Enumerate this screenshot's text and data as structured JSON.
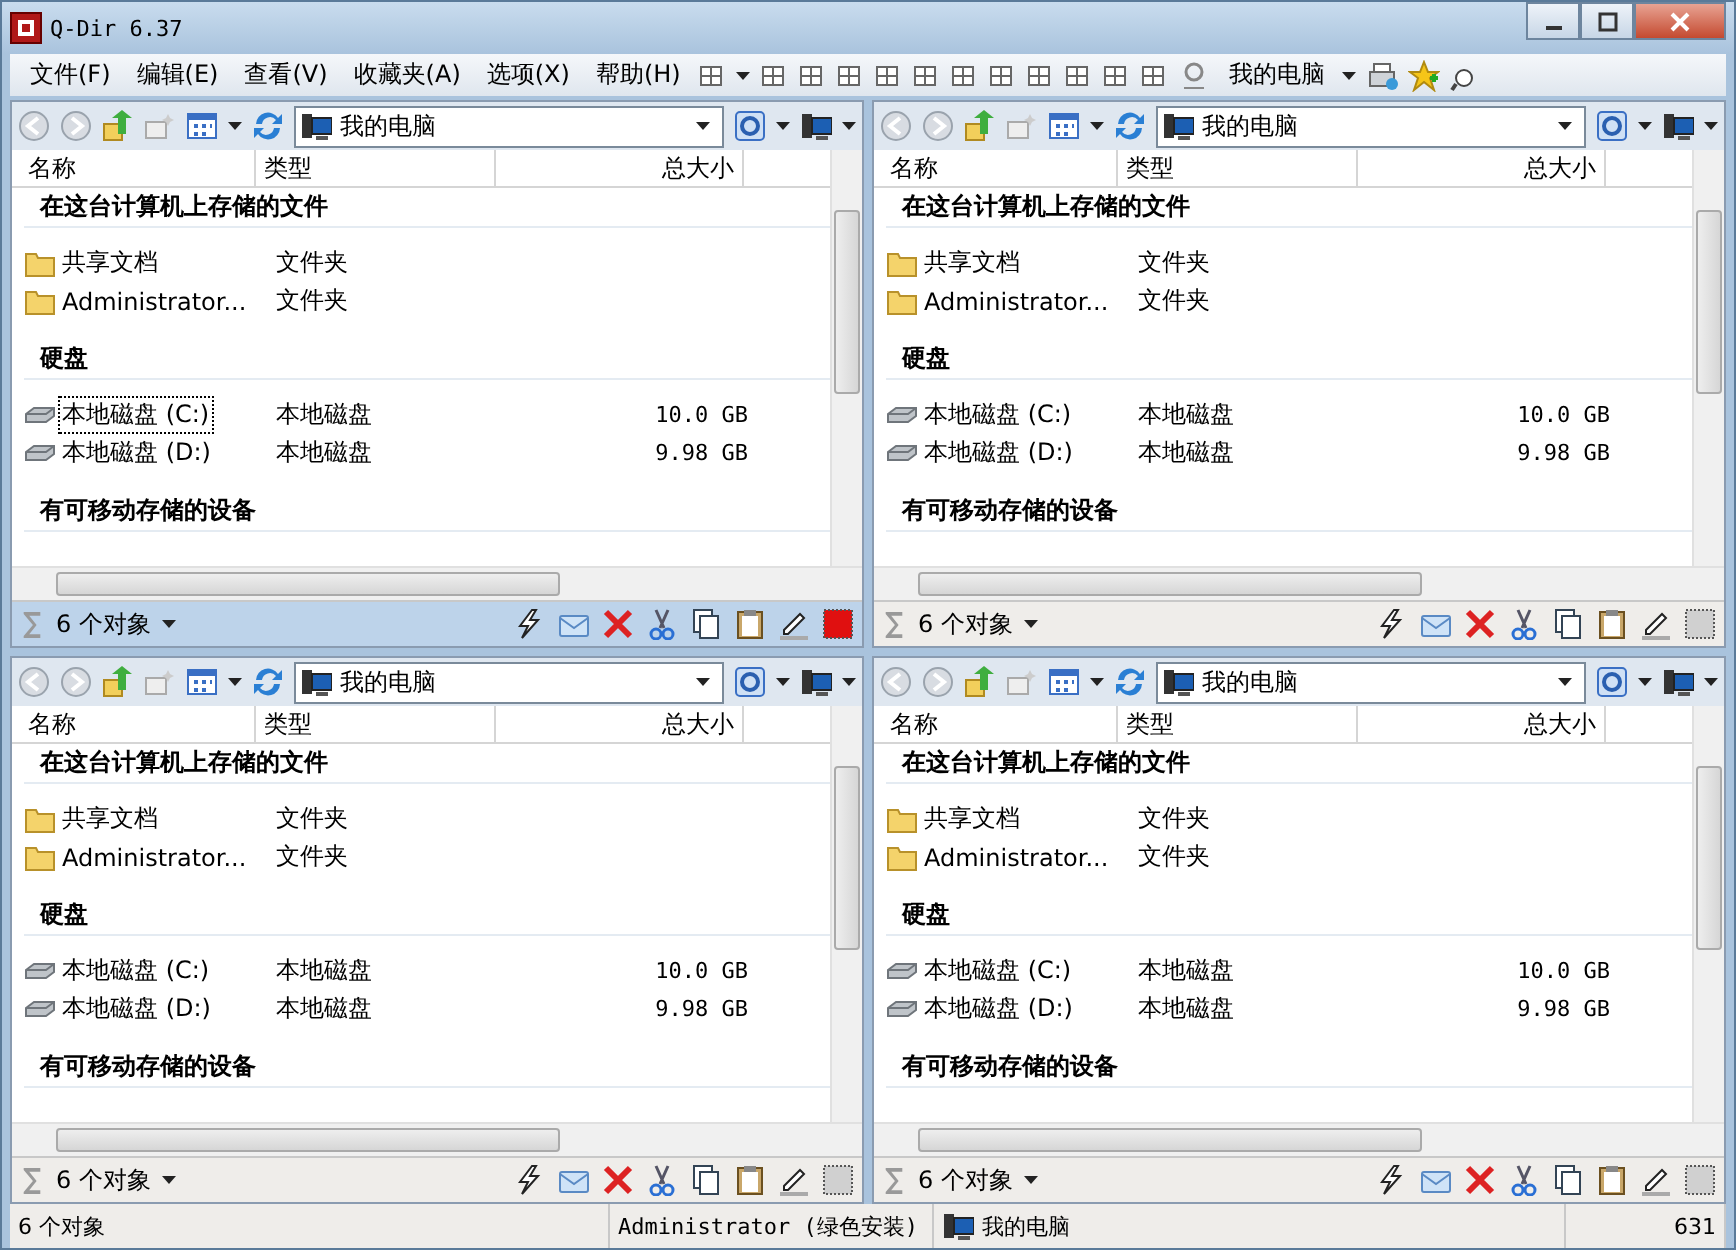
{
  "window": {
    "title": "Q-Dir 6.37"
  },
  "menu": [
    {
      "label": "文件(F)"
    },
    {
      "label": "编辑(E)"
    },
    {
      "label": "查看(V)"
    },
    {
      "label": "收藏夹(A)"
    },
    {
      "label": "选项(X)"
    },
    {
      "label": "帮助(H)"
    }
  ],
  "toolbar": {
    "location": "我的电脑"
  },
  "panes": [
    {
      "selected": true,
      "address": "我的电脑",
      "columns": [
        "名称",
        "类型",
        "总大小"
      ],
      "status": "6 个对象",
      "groups": [
        {
          "title": "在这台计算机上存储的文件",
          "items": [
            {
              "kind": "folder",
              "name": "共享文档",
              "type": "文件夹",
              "focused": false
            },
            {
              "kind": "folder",
              "name": "Administrator...",
              "type": "文件夹",
              "focused": false
            }
          ]
        },
        {
          "title": "硬盘",
          "items": [
            {
              "kind": "drive",
              "name": "本地磁盘 (C:)",
              "type": "本地磁盘",
              "size": "10.0 GB",
              "focused": true
            },
            {
              "kind": "drive",
              "name": "本地磁盘 (D:)",
              "type": "本地磁盘",
              "size": "9.98 GB",
              "focused": false
            }
          ]
        },
        {
          "title": "有可移动存储的设备"
        }
      ]
    },
    {
      "selected": false,
      "address": "我的电脑",
      "columns": [
        "名称",
        "类型",
        "总大小"
      ],
      "status": "6 个对象",
      "groups": [
        {
          "title": "在这台计算机上存储的文件",
          "items": [
            {
              "kind": "folder",
              "name": "共享文档",
              "type": "文件夹",
              "focused": false
            },
            {
              "kind": "folder",
              "name": "Administrator...",
              "type": "文件夹",
              "focused": false
            }
          ]
        },
        {
          "title": "硬盘",
          "items": [
            {
              "kind": "drive",
              "name": "本地磁盘 (C:)",
              "type": "本地磁盘",
              "size": "10.0 GB",
              "focused": false
            },
            {
              "kind": "drive",
              "name": "本地磁盘 (D:)",
              "type": "本地磁盘",
              "size": "9.98 GB",
              "focused": false
            }
          ]
        },
        {
          "title": "有可移动存储的设备"
        }
      ]
    },
    {
      "selected": false,
      "address": "我的电脑",
      "columns": [
        "名称",
        "类型",
        "总大小"
      ],
      "status": "6 个对象",
      "groups": [
        {
          "title": "在这台计算机上存储的文件",
          "items": [
            {
              "kind": "folder",
              "name": "共享文档",
              "type": "文件夹",
              "focused": false
            },
            {
              "kind": "folder",
              "name": "Administrator...",
              "type": "文件夹",
              "focused": false
            }
          ]
        },
        {
          "title": "硬盘",
          "items": [
            {
              "kind": "drive",
              "name": "本地磁盘 (C:)",
              "type": "本地磁盘",
              "size": "10.0 GB",
              "focused": false
            },
            {
              "kind": "drive",
              "name": "本地磁盘 (D:)",
              "type": "本地磁盘",
              "size": "9.98 GB",
              "focused": false
            }
          ]
        },
        {
          "title": "有可移动存储的设备"
        }
      ]
    },
    {
      "selected": false,
      "address": "我的电脑",
      "columns": [
        "名称",
        "类型",
        "总大小"
      ],
      "status": "6 个对象",
      "groups": [
        {
          "title": "在这台计算机上存储的文件",
          "items": [
            {
              "kind": "folder",
              "name": "共享文档",
              "type": "文件夹",
              "focused": false
            },
            {
              "kind": "folder",
              "name": "Administrator...",
              "type": "文件夹",
              "focused": false
            }
          ]
        },
        {
          "title": "硬盘",
          "items": [
            {
              "kind": "drive",
              "name": "本地磁盘 (C:)",
              "type": "本地磁盘",
              "size": "10.0 GB",
              "focused": false
            },
            {
              "kind": "drive",
              "name": "本地磁盘 (D:)",
              "type": "本地磁盘",
              "size": "9.98 GB",
              "focused": false
            }
          ]
        },
        {
          "title": "有可移动存储的设备"
        }
      ]
    }
  ],
  "status_bar": {
    "count": "6 个对象",
    "user": "Administrator (绿色安装)",
    "location": "我的电脑",
    "number": "631"
  }
}
